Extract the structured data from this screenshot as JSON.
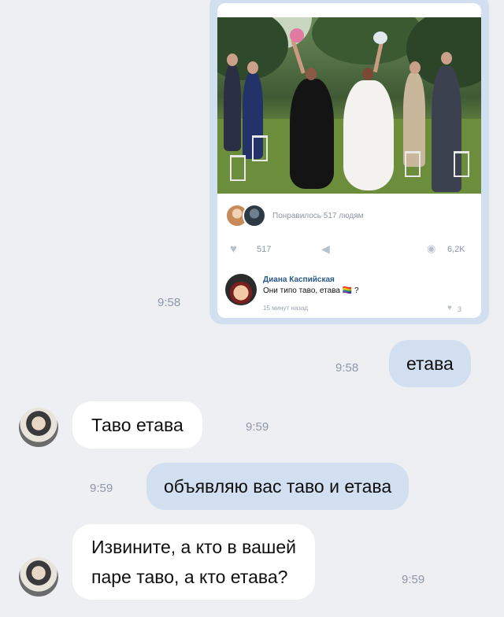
{
  "forwarded_post": {
    "liked_by": "Понравилось 517 людям",
    "likes": "517",
    "views": "6,2K",
    "comment": {
      "author": "Диана Каспийская",
      "text": "Они типо таво, етава",
      "emoji_flag": "🏳️‍🌈",
      "question_mark": "?",
      "time": "15 минут назад",
      "likes": "3"
    },
    "sent_time": "9:58"
  },
  "messages": [
    {
      "direction": "out",
      "text": "етава",
      "time": "9:58"
    },
    {
      "direction": "in",
      "text": "Таво етава",
      "time": "9:59"
    },
    {
      "direction": "out",
      "text": "объявляю вас таво и етава",
      "time": "9:59"
    },
    {
      "direction": "in",
      "text_lines": [
        "Извините, а кто в вашей",
        "паре таво, а кто етава?"
      ],
      "time": "9:59"
    }
  ],
  "icons": {
    "heart": "heart-icon",
    "share": "megaphone-icon",
    "views": "eye-icon"
  },
  "colors": {
    "background": "#edeff3",
    "outgoing_bubble": "#d2dff0",
    "incoming_bubble": "#ffffff",
    "link_name": "#2a5885",
    "meta_text": "#8d98a8"
  }
}
